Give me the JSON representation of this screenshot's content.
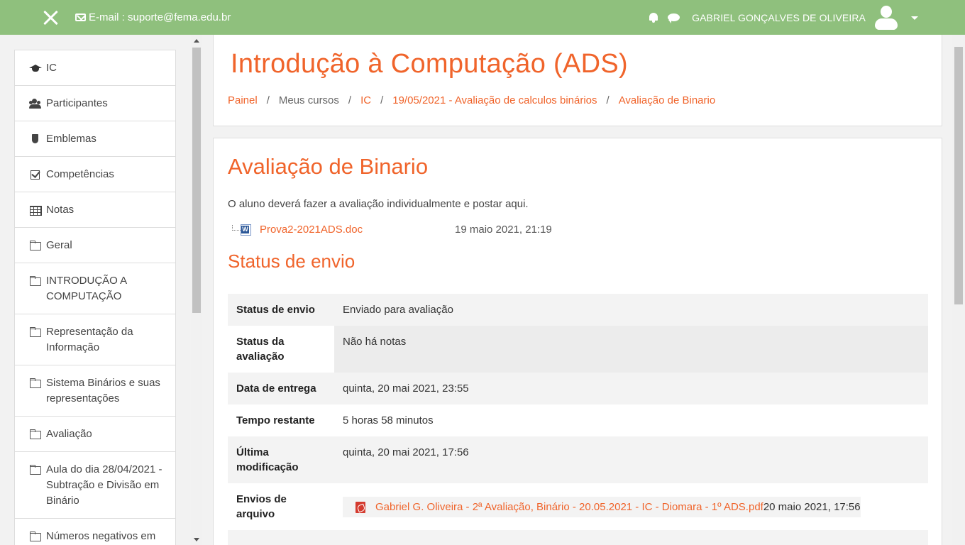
{
  "navbar": {
    "email_text": "E-mail : suporte@fema.edu.br",
    "user_name": "GABRIEL GONÇALVES DE OLIVEIRA"
  },
  "sidebar": {
    "items": [
      {
        "label": "IC",
        "icon": "graduation-cap-icon"
      },
      {
        "label": "Participantes",
        "icon": "users-icon"
      },
      {
        "label": "Emblemas",
        "icon": "shield-icon"
      },
      {
        "label": "Competências",
        "icon": "check-square-icon"
      },
      {
        "label": "Notas",
        "icon": "table-icon"
      },
      {
        "label": "Geral",
        "icon": "folder-icon"
      },
      {
        "label": "INTRODUÇÃO A COMPUTAÇÃO",
        "icon": "folder-icon"
      },
      {
        "label": "Representação da Informação",
        "icon": "folder-icon"
      },
      {
        "label": "Sistema Binários e suas representações",
        "icon": "folder-icon"
      },
      {
        "label": "Avaliação",
        "icon": "folder-icon"
      },
      {
        "label": "Aula do dia 28/04/2021 - Subtração e Divisão em Binário",
        "icon": "folder-icon"
      },
      {
        "label": "Números negativos em Binário -",
        "icon": "folder-icon"
      }
    ]
  },
  "header": {
    "course_title": "Introdução à Computação (ADS)",
    "breadcrumb": [
      "Painel",
      "Meus cursos",
      "IC",
      "19/05/2021 - Avaliação de calculos binários",
      "Avaliação de Binario"
    ],
    "separator": "/"
  },
  "assignment": {
    "title": "Avaliação de Binario",
    "intro": "O aluno deverá fazer a avaliação individualmente e postar aqui.",
    "file_name": "Prova2-2021ADS.doc",
    "file_date": "19 maio 2021, 21:19",
    "status_heading": "Status de envio"
  },
  "status_table": {
    "rows": [
      {
        "key": "Status de envio",
        "value": "Enviado para avaliação"
      },
      {
        "key": "Status da avaliação",
        "value": "Não há notas"
      },
      {
        "key": "Data de entrega",
        "value": "quinta, 20 mai 2021, 23:55"
      },
      {
        "key": "Tempo restante",
        "value": "5 horas 58 minutos"
      },
      {
        "key": "Última modificação",
        "value": "quinta, 20 mai 2021, 17:56"
      },
      {
        "key": "Envios de arquivo",
        "value": ""
      }
    ],
    "submission_file": "Gabriel G. Oliveira - 2ª Avaliação, Binário - 20.05.2021 - IC - Diomara - 1º ADS.pdf",
    "submission_date": "20 maio 2021, 17:56"
  },
  "colors": {
    "navbar": "#8fc07d",
    "accent": "#f0642b"
  }
}
